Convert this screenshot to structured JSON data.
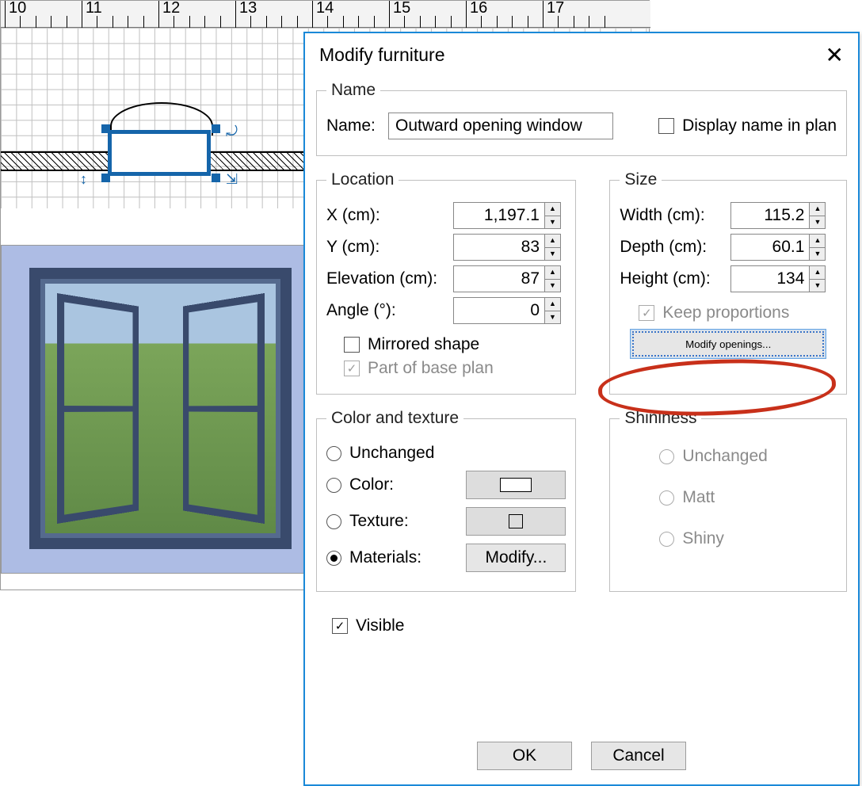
{
  "ruler": {
    "marks": [
      10,
      11,
      12,
      13,
      14,
      15,
      16,
      17
    ]
  },
  "dialog": {
    "title": "Modify furniture",
    "name_group": {
      "legend": "Name",
      "label": "Name:",
      "value": "Outward opening window",
      "display_in_plan": "Display name in plan"
    },
    "location": {
      "legend": "Location",
      "x_label": "X (cm):",
      "x": "1,197.1",
      "y_label": "Y (cm):",
      "y": "83",
      "elev_label": "Elevation (cm):",
      "elev": "87",
      "angle_label": "Angle (°):",
      "angle": "0",
      "mirrored": "Mirrored shape",
      "base_plan": "Part of base plan"
    },
    "size": {
      "legend": "Size",
      "width_label": "Width (cm):",
      "width": "115.2",
      "depth_label": "Depth (cm):",
      "depth": "60.1",
      "height_label": "Height (cm):",
      "height": "134",
      "keep": "Keep proportions",
      "modify_openings": "Modify openings..."
    },
    "color_texture": {
      "legend": "Color and texture",
      "unchanged": "Unchanged",
      "color": "Color:",
      "texture": "Texture:",
      "materials": "Materials:",
      "modify": "Modify..."
    },
    "shininess": {
      "legend": "Shininess",
      "unchanged": "Unchanged",
      "matt": "Matt",
      "shiny": "Shiny"
    },
    "visible": "Visible",
    "ok": "OK",
    "cancel": "Cancel"
  }
}
